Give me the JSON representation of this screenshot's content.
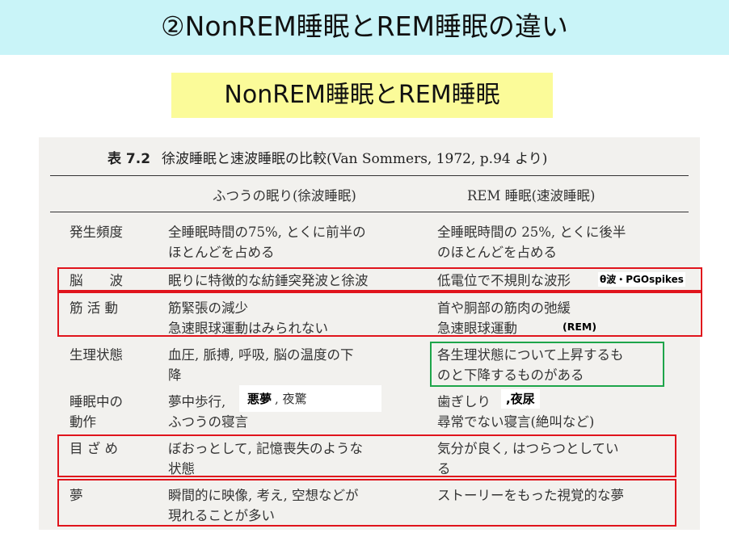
{
  "slide": {
    "title": "②NonREM睡眠とREM睡眠の違い",
    "subtitle": "NonREM睡眠とREM睡眠"
  },
  "table": {
    "caption_number": "表 7.2",
    "caption_text": "徐波睡眠と速波睡眠の比較(Van Sommers, 1972, p.94 より)",
    "columns": [
      "ふつうの眠り(徐波睡眠)",
      "REM 睡眠(速波睡眠)"
    ],
    "rows": [
      {
        "label": [
          "発生頻度"
        ],
        "nonrem": [
          "全睡眠時間の75%, とくに前半の",
          "ほとんどを占める"
        ],
        "rem": [
          "全睡眠時間の 25%, とくに後半",
          "のほとんどを占める"
        ]
      },
      {
        "label": [
          "脳　　波"
        ],
        "nonrem": [
          "眠りに特徴的な紡錘突発波と徐波"
        ],
        "rem": [
          "低電位で不規則な波形"
        ]
      },
      {
        "label": [
          "筋 活 動"
        ],
        "nonrem": [
          "筋緊張の減少",
          "急速眼球運動はみられない"
        ],
        "rem": [
          "首や胴部の筋肉の弛緩",
          "急速眼球運動"
        ]
      },
      {
        "label": [
          "生理状態"
        ],
        "nonrem": [
          "血圧, 脈搏, 呼吸, 脳の温度の下",
          "降"
        ],
        "rem": [
          "各生理状態について上昇するも",
          "のと下降するものがある"
        ]
      },
      {
        "label": [
          "睡眠中の",
          "動作"
        ],
        "nonrem": [
          "夢中歩行,",
          "ふつうの寝言"
        ],
        "rem": [
          "歯ぎしり",
          "尋常でない寝言(絶叫など)"
        ]
      },
      {
        "label": [
          "目 ざ め"
        ],
        "nonrem": [
          "ぼおっとして, 記憶喪失のような",
          "状態"
        ],
        "rem": [
          "気分が良く, はつらつとしてい",
          "る"
        ]
      },
      {
        "label": [
          "夢"
        ],
        "nonrem": [
          "瞬間的に映像, 考え, 空想などが",
          "現れることが多い"
        ],
        "rem": [
          "ストーリーをもった視覚的な夢"
        ]
      }
    ]
  },
  "annotations": {
    "brainwave": "θ波・PGOspikes",
    "rem_eye": "(REM)",
    "nightmare": "悪夢",
    "nightmare_suffix": ", 夜驚",
    "bedwetting": ",夜尿"
  },
  "colors": {
    "banner": "#c9f4f8",
    "subtitle_bg": "#fbfb99",
    "highlight_red": "#e0141c",
    "highlight_green": "#1ea54a"
  }
}
